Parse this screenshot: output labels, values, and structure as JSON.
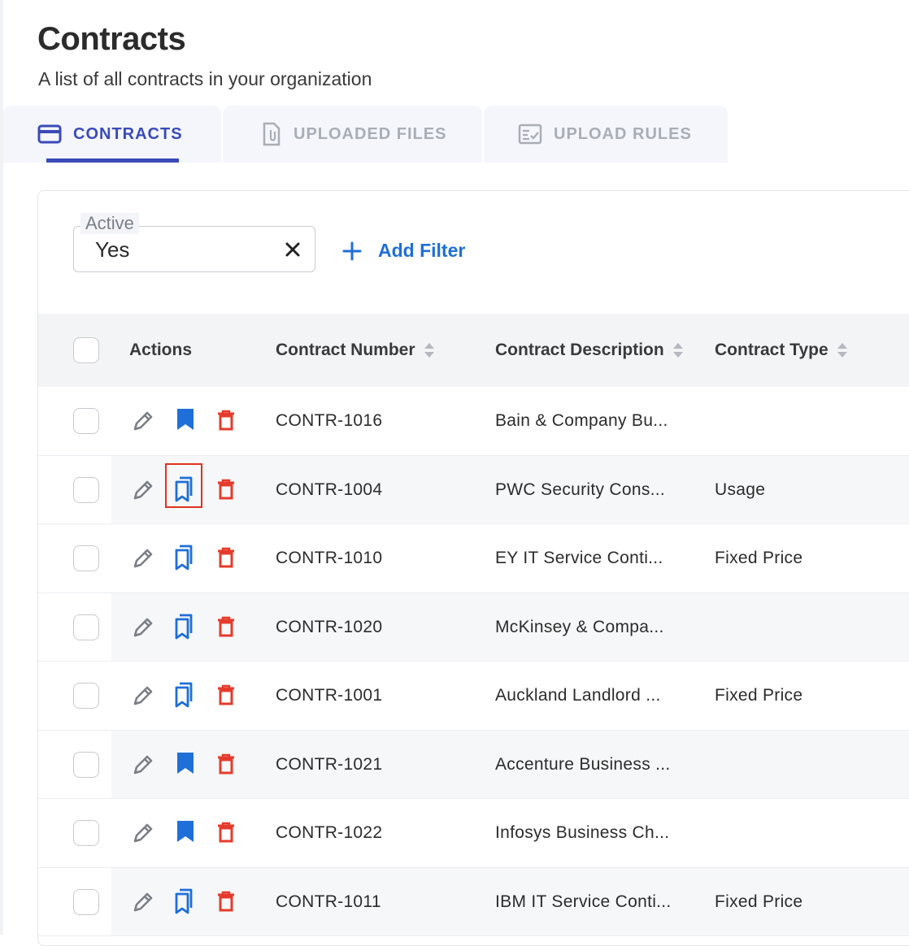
{
  "page": {
    "title": "Contracts",
    "subtitle": "A list of all contracts in your organization"
  },
  "tabs": [
    {
      "label": "CONTRACTS",
      "icon": "credit-card-icon",
      "active": true
    },
    {
      "label": "UPLOADED FILES",
      "icon": "file-attachment-icon",
      "active": false
    },
    {
      "label": "UPLOAD RULES",
      "icon": "checklist-icon",
      "active": false
    }
  ],
  "filter": {
    "legend": "Active",
    "value": "Yes",
    "add_label": "Add Filter"
  },
  "table": {
    "columns": {
      "actions": "Actions",
      "number": "Contract Number",
      "description": "Contract Description",
      "type": "Contract Type"
    },
    "rows": [
      {
        "number": "CONTR-1016",
        "description": "Bain & Company Bu...",
        "type": "",
        "bookmarked": true
      },
      {
        "number": "CONTR-1004",
        "description": "PWC Security Cons...",
        "type": "Usage",
        "bookmarked": false
      },
      {
        "number": "CONTR-1010",
        "description": "EY IT Service Conti...",
        "type": "Fixed Price",
        "bookmarked": false
      },
      {
        "number": "CONTR-1020",
        "description": "McKinsey & Compa...",
        "type": "",
        "bookmarked": false
      },
      {
        "number": "CONTR-1001",
        "description": "Auckland Landlord ...",
        "type": "Fixed Price",
        "bookmarked": false
      },
      {
        "number": "CONTR-1021",
        "description": "Accenture Business ...",
        "type": "",
        "bookmarked": true
      },
      {
        "number": "CONTR-1022",
        "description": "Infosys Business Ch...",
        "type": "",
        "bookmarked": true
      },
      {
        "number": "CONTR-1011",
        "description": "IBM IT Service Conti...",
        "type": "Fixed Price",
        "bookmarked": false
      }
    ]
  },
  "colors": {
    "accent": "#3b4ab8",
    "link": "#1f6fd8",
    "delete": "#e53b2c",
    "edit": "#7b7f86",
    "highlight": "#e0321e"
  }
}
